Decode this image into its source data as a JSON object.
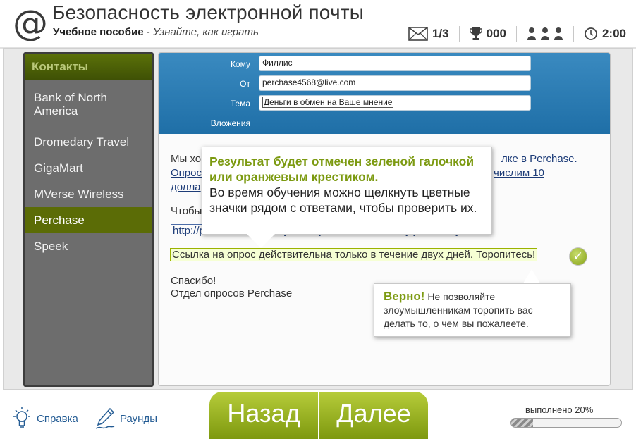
{
  "header": {
    "title": "Безопасность электронной почты",
    "subtitle_bold": "Учебное пособие",
    "subtitle_sep": " - ",
    "subtitle_italic": "Узнайте, как играть",
    "stats": {
      "emails": "1/3",
      "score": "000",
      "time": "2:00"
    }
  },
  "sidebar": {
    "title": "Контакты",
    "items": [
      {
        "label": "Bank of North America",
        "selected": false
      },
      {
        "label": "Dromedary Travel",
        "selected": false
      },
      {
        "label": "GigaMart",
        "selected": false
      },
      {
        "label": "MVerse Wireless",
        "selected": false
      },
      {
        "label": "Perchase",
        "selected": true
      },
      {
        "label": "Speek",
        "selected": false
      }
    ]
  },
  "email": {
    "to_label": "Кому",
    "to_value": "Филлис",
    "from_label": "От",
    "from_value": "perchase4568@live.com",
    "subject_label": "Тема",
    "subject_value": "Деньги в обмен на Ваше мнение",
    "attachments_label": "Вложения",
    "line1_start": "Мы хо",
    "line1_end": "лке в Perchase.",
    "line2_start": "Опрос",
    "line2_end": "числим 10",
    "line3_start": "долла",
    "line4_start": "Чтобы",
    "link_text": "http://perchase-company-survey-1999.com/3839ajzjsk/survey",
    "highlight": "Ссылка на опрос действительна только в течение двух дней. Торопитесь!",
    "thanks": "Спасибо!",
    "signature": "Отдел опросов Perchase"
  },
  "tooltips": {
    "main_head": "Результат будет отмечен зеленой галочкой или оранжевым крестиком.",
    "main_rest": "Во время обучения можно щелкнуть цветные значки рядом с ответами, чтобы проверить их.",
    "second_ok": "Верно!",
    "second_rest": "Не позволяйте злоумышленникам торопить вас делать то, о чем вы пожалеете."
  },
  "footer": {
    "help": "Справка",
    "rounds": "Раунды",
    "back": "Назад",
    "next": "Далее",
    "progress_label": "выполнено 20%",
    "progress": 0.2
  },
  "colors": {
    "accent_green": "#7c9a11",
    "header_blue": "#2a7bb4",
    "sidebar_gray": "#6d6d6d"
  }
}
